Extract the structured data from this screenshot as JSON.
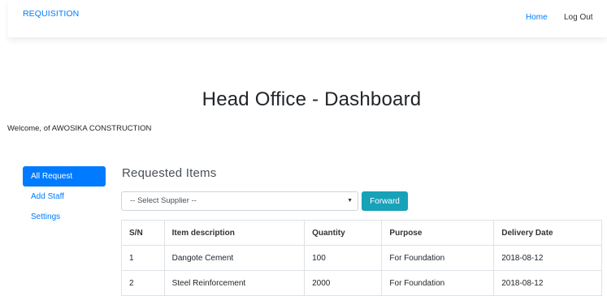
{
  "navbar": {
    "brand": "REQUISITION",
    "links": [
      {
        "label": "Home"
      },
      {
        "label": "Log Out"
      }
    ]
  },
  "page": {
    "title": "Head Office - Dashboard",
    "welcome": "Welcome, of AWOSIKA CONSTRUCTION"
  },
  "sidebar": {
    "items": [
      {
        "label": "All Request",
        "active": true
      },
      {
        "label": "Add Staff",
        "active": false
      },
      {
        "label": "Settings",
        "active": false
      }
    ]
  },
  "main": {
    "section_title": "Requested Items",
    "supplier_select": {
      "selected": "-- Select Supplier --"
    },
    "forward_label": "Forward",
    "table": {
      "headers": [
        "S/N",
        "Item description",
        "Quantity",
        "Purpose",
        "Delivery Date"
      ],
      "rows": [
        [
          "1",
          "Dangote Cement",
          "100",
          "For Foundation",
          "2018-08-12"
        ],
        [
          "2",
          "Steel Reinforcement",
          "2000",
          "For Foundation",
          "2018-08-12"
        ]
      ]
    }
  },
  "colors": {
    "primary": "#007bff",
    "info": "#17a2b8"
  }
}
